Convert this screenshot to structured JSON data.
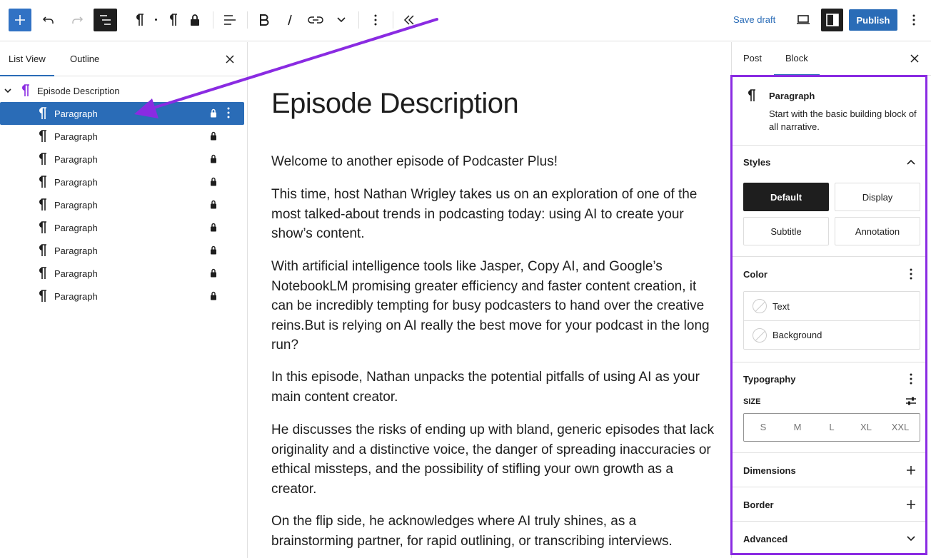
{
  "toolbar": {
    "add_icon": "plus-icon",
    "undo_icon": "undo-icon",
    "redo_icon": "redo-icon",
    "list_view_icon": "list-view-icon",
    "save_draft_label": "Save draft",
    "publish_label": "Publish"
  },
  "left_panel": {
    "tabs": [
      "List View",
      "Outline"
    ],
    "active_tab": "List View",
    "parent": {
      "label": "Episode Description"
    },
    "items": [
      {
        "label": "Paragraph",
        "selected": true
      },
      {
        "label": "Paragraph",
        "selected": false
      },
      {
        "label": "Paragraph",
        "selected": false
      },
      {
        "label": "Paragraph",
        "selected": false
      },
      {
        "label": "Paragraph",
        "selected": false
      },
      {
        "label": "Paragraph",
        "selected": false
      },
      {
        "label": "Paragraph",
        "selected": false
      },
      {
        "label": "Paragraph",
        "selected": false
      },
      {
        "label": "Paragraph",
        "selected": false
      }
    ]
  },
  "editor": {
    "title": "Episode Description",
    "paragraphs": [
      "Welcome to another episode of Podcaster Plus!",
      "This time, host Nathan Wrigley takes us on an exploration of one of the most talked-about trends in podcasting today: using AI to create your show’s content.",
      "With artificial intelligence tools like Jasper, Copy AI, and Google’s NotebookLM promising greater efficiency and faster content creation, it can be incredibly tempting for busy podcasters to hand over the creative reins.But is relying on AI really the best move for your podcast in the long run?",
      "In this episode, Nathan unpacks the potential pitfalls of using AI as your main content creator.",
      "He discusses the risks of ending up with bland, generic episodes that lack originality and a distinctive voice, the danger of spreading inaccuracies or ethical missteps, and the possibility of stifling your own growth as a creator.",
      "On the flip side, he acknowledges where AI truly shines, as a brainstorming partner, for rapid outlining, or transcribing interviews."
    ]
  },
  "right_panel": {
    "tabs": [
      "Post",
      "Block"
    ],
    "active_tab": "Block",
    "block": {
      "name": "Paragraph",
      "description": "Start with the basic building block of all narrative."
    },
    "styles": {
      "title": "Styles",
      "options": [
        "Default",
        "Display",
        "Subtitle",
        "Annotation"
      ],
      "active": "Default"
    },
    "color": {
      "title": "Color",
      "items": [
        "Text",
        "Background"
      ]
    },
    "typography": {
      "title": "Typography",
      "size_label": "SIZE",
      "sizes": [
        "S",
        "M",
        "L",
        "XL",
        "XXL"
      ]
    },
    "dimensions": {
      "title": "Dimensions"
    },
    "border": {
      "title": "Border"
    },
    "advanced": {
      "title": "Advanced"
    }
  },
  "colors": {
    "accent": "#2a6cb7",
    "annotation": "#8a2be2"
  }
}
